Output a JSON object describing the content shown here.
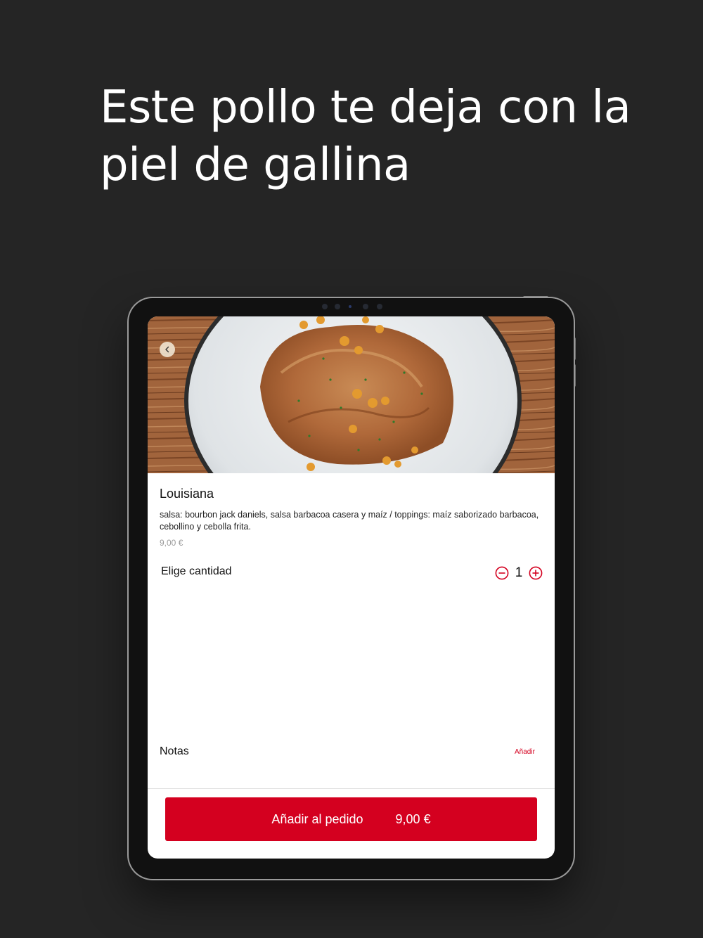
{
  "headline": "Este pollo te deja con la piel de gallina",
  "product": {
    "name": "Louisiana",
    "description": "salsa: bourbon jack daniels, salsa barbacoa casera y maíz / toppings: maíz saborizado barbacoa, cebollino y cebolla frita.",
    "price": "9,00 €"
  },
  "quantity": {
    "label": "Elige cantidad",
    "value": "1"
  },
  "notes": {
    "label": "Notas",
    "add_label": "Añadir"
  },
  "order_button": {
    "label": "Añadir al pedido",
    "total": "9,00 €"
  },
  "colors": {
    "accent": "#d4001f",
    "background": "#252525"
  },
  "icons": [
    "chevron-left-icon",
    "minus-circle-icon",
    "plus-circle-icon"
  ]
}
